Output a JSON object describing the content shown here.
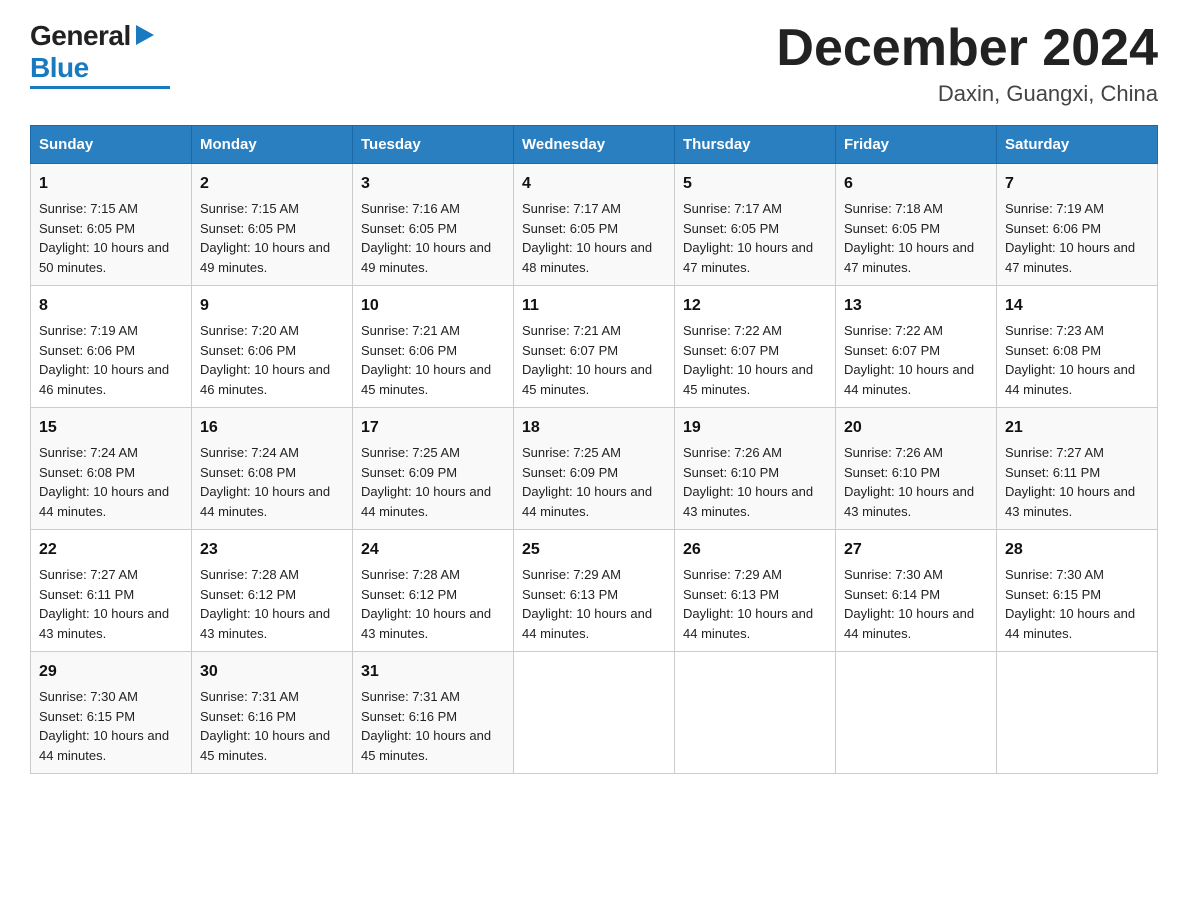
{
  "header": {
    "title": "December 2024",
    "subtitle": "Daxin, Guangxi, China",
    "logo_general": "General",
    "logo_blue": "Blue"
  },
  "weekdays": [
    "Sunday",
    "Monday",
    "Tuesday",
    "Wednesday",
    "Thursday",
    "Friday",
    "Saturday"
  ],
  "weeks": [
    [
      {
        "day": "1",
        "sunrise": "7:15 AM",
        "sunset": "6:05 PM",
        "daylight": "10 hours and 50 minutes."
      },
      {
        "day": "2",
        "sunrise": "7:15 AM",
        "sunset": "6:05 PM",
        "daylight": "10 hours and 49 minutes."
      },
      {
        "day": "3",
        "sunrise": "7:16 AM",
        "sunset": "6:05 PM",
        "daylight": "10 hours and 49 minutes."
      },
      {
        "day": "4",
        "sunrise": "7:17 AM",
        "sunset": "6:05 PM",
        "daylight": "10 hours and 48 minutes."
      },
      {
        "day": "5",
        "sunrise": "7:17 AM",
        "sunset": "6:05 PM",
        "daylight": "10 hours and 47 minutes."
      },
      {
        "day": "6",
        "sunrise": "7:18 AM",
        "sunset": "6:05 PM",
        "daylight": "10 hours and 47 minutes."
      },
      {
        "day": "7",
        "sunrise": "7:19 AM",
        "sunset": "6:06 PM",
        "daylight": "10 hours and 47 minutes."
      }
    ],
    [
      {
        "day": "8",
        "sunrise": "7:19 AM",
        "sunset": "6:06 PM",
        "daylight": "10 hours and 46 minutes."
      },
      {
        "day": "9",
        "sunrise": "7:20 AM",
        "sunset": "6:06 PM",
        "daylight": "10 hours and 46 minutes."
      },
      {
        "day": "10",
        "sunrise": "7:21 AM",
        "sunset": "6:06 PM",
        "daylight": "10 hours and 45 minutes."
      },
      {
        "day": "11",
        "sunrise": "7:21 AM",
        "sunset": "6:07 PM",
        "daylight": "10 hours and 45 minutes."
      },
      {
        "day": "12",
        "sunrise": "7:22 AM",
        "sunset": "6:07 PM",
        "daylight": "10 hours and 45 minutes."
      },
      {
        "day": "13",
        "sunrise": "7:22 AM",
        "sunset": "6:07 PM",
        "daylight": "10 hours and 44 minutes."
      },
      {
        "day": "14",
        "sunrise": "7:23 AM",
        "sunset": "6:08 PM",
        "daylight": "10 hours and 44 minutes."
      }
    ],
    [
      {
        "day": "15",
        "sunrise": "7:24 AM",
        "sunset": "6:08 PM",
        "daylight": "10 hours and 44 minutes."
      },
      {
        "day": "16",
        "sunrise": "7:24 AM",
        "sunset": "6:08 PM",
        "daylight": "10 hours and 44 minutes."
      },
      {
        "day": "17",
        "sunrise": "7:25 AM",
        "sunset": "6:09 PM",
        "daylight": "10 hours and 44 minutes."
      },
      {
        "day": "18",
        "sunrise": "7:25 AM",
        "sunset": "6:09 PM",
        "daylight": "10 hours and 44 minutes."
      },
      {
        "day": "19",
        "sunrise": "7:26 AM",
        "sunset": "6:10 PM",
        "daylight": "10 hours and 43 minutes."
      },
      {
        "day": "20",
        "sunrise": "7:26 AM",
        "sunset": "6:10 PM",
        "daylight": "10 hours and 43 minutes."
      },
      {
        "day": "21",
        "sunrise": "7:27 AM",
        "sunset": "6:11 PM",
        "daylight": "10 hours and 43 minutes."
      }
    ],
    [
      {
        "day": "22",
        "sunrise": "7:27 AM",
        "sunset": "6:11 PM",
        "daylight": "10 hours and 43 minutes."
      },
      {
        "day": "23",
        "sunrise": "7:28 AM",
        "sunset": "6:12 PM",
        "daylight": "10 hours and 43 minutes."
      },
      {
        "day": "24",
        "sunrise": "7:28 AM",
        "sunset": "6:12 PM",
        "daylight": "10 hours and 43 minutes."
      },
      {
        "day": "25",
        "sunrise": "7:29 AM",
        "sunset": "6:13 PM",
        "daylight": "10 hours and 44 minutes."
      },
      {
        "day": "26",
        "sunrise": "7:29 AM",
        "sunset": "6:13 PM",
        "daylight": "10 hours and 44 minutes."
      },
      {
        "day": "27",
        "sunrise": "7:30 AM",
        "sunset": "6:14 PM",
        "daylight": "10 hours and 44 minutes."
      },
      {
        "day": "28",
        "sunrise": "7:30 AM",
        "sunset": "6:15 PM",
        "daylight": "10 hours and 44 minutes."
      }
    ],
    [
      {
        "day": "29",
        "sunrise": "7:30 AM",
        "sunset": "6:15 PM",
        "daylight": "10 hours and 44 minutes."
      },
      {
        "day": "30",
        "sunrise": "7:31 AM",
        "sunset": "6:16 PM",
        "daylight": "10 hours and 45 minutes."
      },
      {
        "day": "31",
        "sunrise": "7:31 AM",
        "sunset": "6:16 PM",
        "daylight": "10 hours and 45 minutes."
      },
      null,
      null,
      null,
      null
    ]
  ]
}
